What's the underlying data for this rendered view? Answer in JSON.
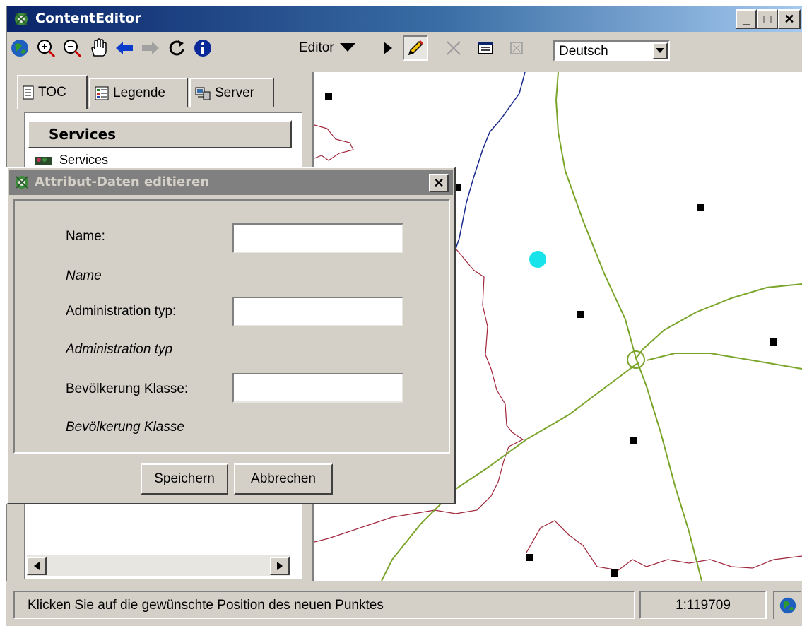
{
  "window": {
    "title": "ContentEditor",
    "controls": [
      "_",
      "□",
      "X"
    ]
  },
  "toolbar": {
    "tools": [
      "globe-icon",
      "zoom-in-icon",
      "zoom-out-icon",
      "pan-hand-icon",
      "back-arrow-icon",
      "forward-arrow-icon",
      "refresh-icon",
      "info-icon"
    ],
    "editor_label": "Editor",
    "edit_tools": [
      "select-arrow-icon",
      "pencil-icon",
      "delete-x-icon",
      "table-icon",
      "disabled-icon"
    ],
    "language": "Deutsch"
  },
  "tabs": {
    "toc": "TOC",
    "legend": "Legende",
    "server": "Server"
  },
  "toc": {
    "header": "Services",
    "item": "Services"
  },
  "dialog": {
    "title": "Attribut-Daten editieren",
    "fields": [
      {
        "label": "Name:",
        "hint": "Name",
        "value": ""
      },
      {
        "label": "Administration typ:",
        "hint": "Administration typ",
        "value": ""
      },
      {
        "label": "Bevölkerung Klasse:",
        "hint": "Bevölkerung Klasse",
        "value": ""
      }
    ],
    "save_label": "Speichern",
    "cancel_label": "Abbrechen"
  },
  "status": {
    "message": "Klicken Sie auf die gewünschte Position des neuen Punktes",
    "scale": "1:119709"
  },
  "colors": {
    "title_bar": "#0a246a",
    "dialog_title_inactive": "#808080",
    "map_boundary": "#a0263c",
    "map_road": "#7aa52a",
    "map_river": "#1a2a8c",
    "selected_point": "#19e3ea"
  }
}
